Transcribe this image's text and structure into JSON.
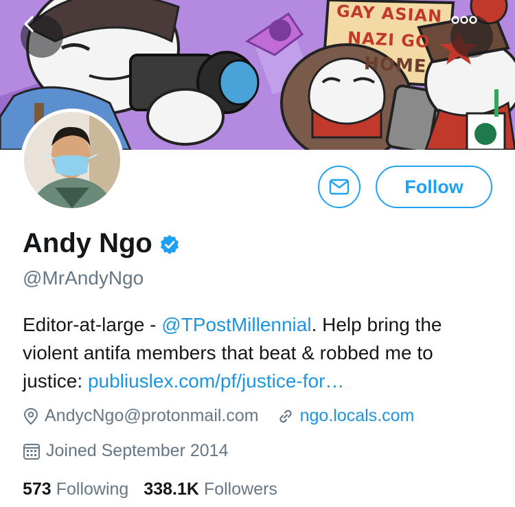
{
  "banner": {
    "sign_text": [
      "GAY ASIAN",
      "NAZI GO",
      "HOME"
    ],
    "colors": {
      "background": "#b98ee0",
      "sign": "#f3d9a4",
      "sign_text": "#c0392b"
    }
  },
  "nav": {
    "back_icon": "chevron-left-icon",
    "more_icon": "ellipsis-icon"
  },
  "actions": {
    "message_icon": "envelope-icon",
    "follow_label": "Follow"
  },
  "profile": {
    "name": "Andy Ngo",
    "verified_icon": "verified-badge-icon",
    "handle": "@MrAndyNgo",
    "bio": {
      "part1": "Editor-at-large - ",
      "mention": "@TPostMillennial",
      "part2": ". Help bring the violent antifa members that beat & robbed me to justice: ",
      "url": "publiuslex.com/pf/justice-for…"
    },
    "email": "AndycNgo@protonmail.com",
    "website": "ngo.locals.com",
    "joined": "Joined September 2014"
  },
  "stats": {
    "following_count": "573",
    "following_label": "Following",
    "followers_count": "338.1K",
    "followers_label": "Followers"
  },
  "colors": {
    "accent": "#1da1f2",
    "link": "#1b95e0",
    "secondary_text": "#657786",
    "primary_text": "#14171a"
  }
}
